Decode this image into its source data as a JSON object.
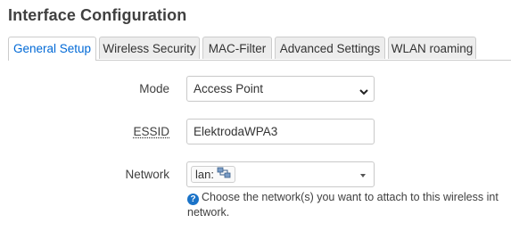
{
  "page": {
    "title": "Interface Configuration"
  },
  "tabs": [
    {
      "label": "General Setup",
      "active": true
    },
    {
      "label": "Wireless Security",
      "active": false
    },
    {
      "label": "MAC-Filter",
      "active": false
    },
    {
      "label": "Advanced Settings",
      "active": false
    },
    {
      "label": "WLAN roaming",
      "active": false
    }
  ],
  "form": {
    "mode": {
      "label": "Mode",
      "value": "Access Point"
    },
    "essid": {
      "label": "ESSID",
      "value": "ElektrodaWPA3"
    },
    "network": {
      "label": "Network",
      "value": "lan:",
      "help_line1": "Choose the network(s) you want to attach to this wireless int",
      "help_line2": "network."
    }
  },
  "colors": {
    "accent": "#0069d6",
    "help_icon": "#1a73c8"
  },
  "icons": {
    "mode_select": "chevron-down-icon",
    "network_select": "caret-down-icon",
    "network_device": "network-ports-icon",
    "help": "question-circle-icon"
  }
}
